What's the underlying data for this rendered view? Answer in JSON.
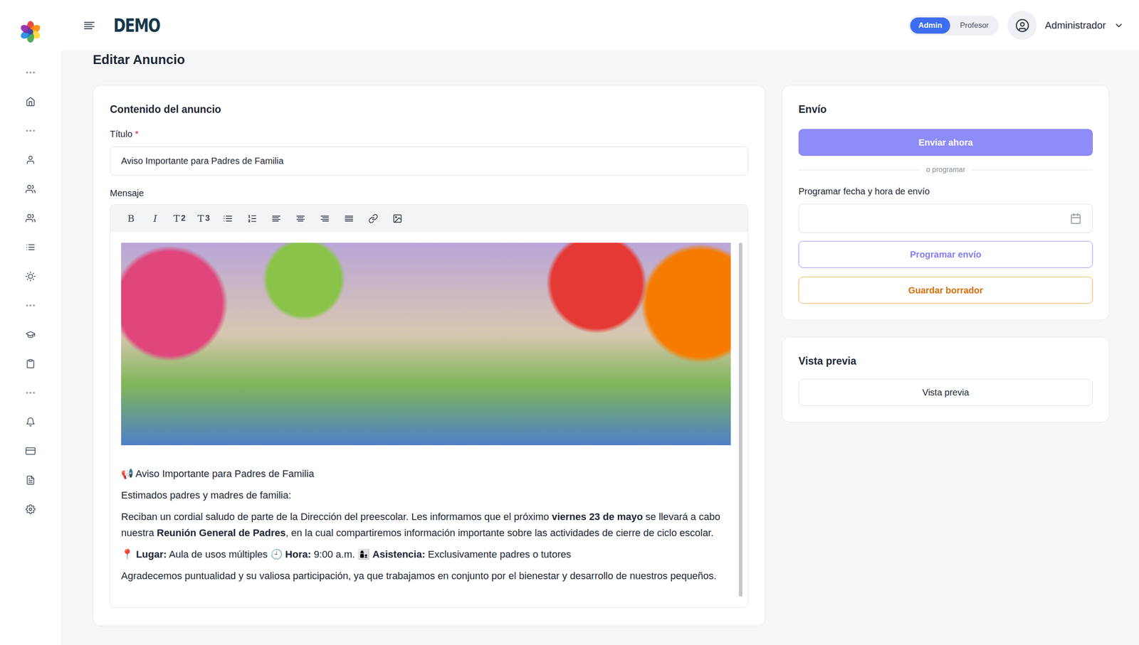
{
  "header": {
    "logo": "DEMO",
    "roles": [
      {
        "label": "Admin",
        "selected": true
      },
      {
        "label": "Profesor",
        "selected": false
      }
    ],
    "user": "Administrador"
  },
  "page_title": "Editar Anuncio",
  "content": {
    "title": "Contenido del anuncio",
    "title_field": {
      "label": "Título",
      "required": "*",
      "value": "Aviso Importante para Padres de Familia"
    },
    "message_label": "Mensaje",
    "toolbar": [
      {
        "kind": "bold",
        "label": "B",
        "sub": ""
      },
      {
        "kind": "italic",
        "label": "I",
        "sub": ""
      },
      {
        "kind": "heading",
        "label": "T",
        "sub": "2"
      },
      {
        "kind": "heading",
        "label": "T",
        "sub": "3"
      }
    ],
    "message": [
      [
        {
          "text": "📢 Aviso Importante para Padres de Familia",
          "bold": false
        }
      ],
      [
        {
          "text": "Estimados padres y madres de familia:",
          "bold": false
        }
      ],
      [
        {
          "text": "Reciban un cordial saludo de parte de la Dirección del preescolar. Les informamos que el próximo ",
          "bold": false
        },
        {
          "text": "viernes 23 de mayo",
          "bold": true
        },
        {
          "text": " se llevará a cabo nuestra ",
          "bold": false
        },
        {
          "text": "Reunión General de Padres",
          "bold": true
        },
        {
          "text": ", en la cual compartiremos información importante sobre las actividades de cierre de ciclo escolar.",
          "bold": false
        }
      ],
      [
        {
          "text": "📍 ",
          "bold": false
        },
        {
          "text": "Lugar:",
          "bold": true
        },
        {
          "text": " Aula de usos múltiples 🕘 ",
          "bold": false
        },
        {
          "text": "Hora:",
          "bold": true
        },
        {
          "text": " 9:00 a.m. 👩‍👦 ",
          "bold": false
        },
        {
          "text": "Asistencia:",
          "bold": true
        },
        {
          "text": " Exclusivamente padres o tutores",
          "bold": false
        }
      ],
      [
        {
          "text": "Agradecemos puntualidad y su valiosa participación, ya que trabajamos en conjunto por el bienestar y desarrollo de nuestros pequeños.",
          "bold": false
        }
      ]
    ]
  },
  "send": {
    "title": "Envío",
    "send_now": "Enviar ahora",
    "divider": "o programar",
    "schedule_label": "Programar fecha y hora de envío",
    "schedule_button": "Programar envío",
    "draft_button": "Guardar borrador"
  },
  "preview": {
    "title": "Vista previa",
    "button": "Vista previa"
  }
}
